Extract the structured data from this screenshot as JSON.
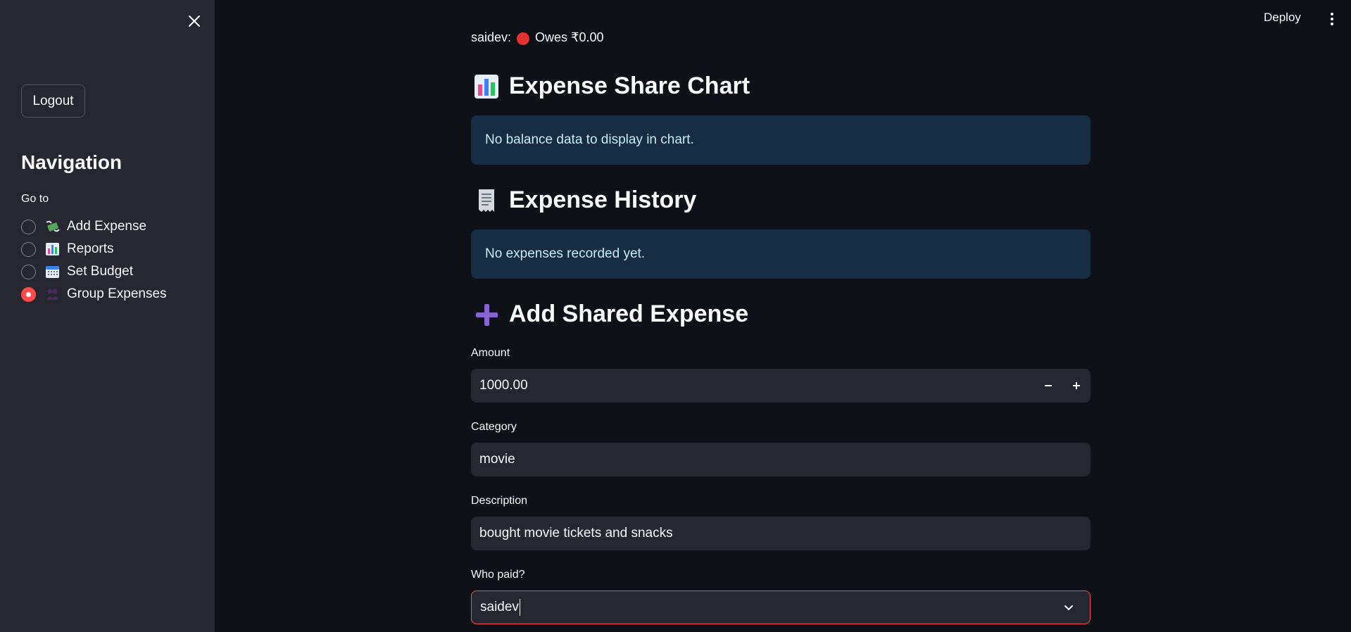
{
  "sidebar": {
    "logout_label": "Logout",
    "nav_title": "Navigation",
    "goto_label": "Go to",
    "items": [
      {
        "label": "Add Expense",
        "icon": "money-with-wings-icon",
        "selected": false
      },
      {
        "label": "Reports",
        "icon": "bar-chart-icon",
        "selected": false
      },
      {
        "label": "Set Budget",
        "icon": "calendar-icon",
        "selected": false
      },
      {
        "label": "Group Expenses",
        "icon": "people-icon",
        "selected": true
      }
    ]
  },
  "topbar": {
    "deploy_label": "Deploy"
  },
  "main": {
    "top_line_name": "saidev:",
    "top_line_text": "Owes ₹0.00",
    "share_chart": {
      "title": "Expense Share Chart",
      "info": "No balance data to display in chart."
    },
    "history": {
      "title": "Expense History",
      "info": "No expenses recorded yet."
    },
    "add_shared": {
      "title": "Add Shared Expense",
      "amount_label": "Amount",
      "amount_value": "1000.00",
      "category_label": "Category",
      "category_value": "movie",
      "description_label": "Description",
      "description_value": "bought movie tickets and snacks",
      "who_paid_label": "Who paid?",
      "who_paid_value": "saidev"
    }
  },
  "colors": {
    "accent": "#ff4b4b",
    "info_bg": "#172d43",
    "info_text": "#c7ebff"
  }
}
